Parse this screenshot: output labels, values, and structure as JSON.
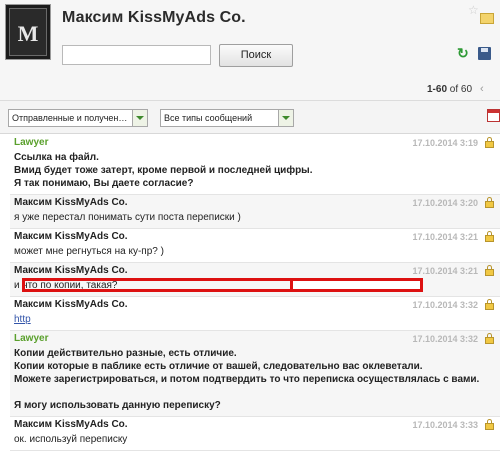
{
  "header": {
    "title": "Максим KissMyAds Co.",
    "avatar_text": "M",
    "search_placeholder": "",
    "search_button": "Поиск",
    "pager": {
      "range": "1-60",
      "of": "of 60"
    }
  },
  "toolbar": {
    "filter_direction": "Отправленные и получен…",
    "filter_type": "Все типы сообщений"
  },
  "messages": [
    {
      "sender": "Lawyer",
      "green": true,
      "date": "17.10.2014 3:19",
      "bold": true,
      "lines": [
        "Ссылка на файл.",
        "Вмид будет тоже затерт, кроме первой и последней цифры.",
        "Я так понимаю, Вы даете согласие?"
      ]
    },
    {
      "sender": "Максим KissMyAds Co.",
      "green": false,
      "date": "17.10.2014 3:20",
      "bold": false,
      "lines": [
        "я уже перестал понимать сути поста переписки )"
      ]
    },
    {
      "sender": "Максим KissMyAds Co.",
      "green": false,
      "date": "17.10.2014 3:21",
      "bold": false,
      "lines": [
        "может мне регнуться на ку-пр? )"
      ]
    },
    {
      "sender": "Максим KissMyAds Co.",
      "green": false,
      "date": "17.10.2014 3:21",
      "bold": false,
      "lines": [
        "и что по копии, такая?"
      ]
    },
    {
      "sender": "Максим KissMyAds Co.",
      "green": false,
      "date": "17.10.2014 3:32",
      "bold": false,
      "link": "http"
    },
    {
      "sender": "Lawyer",
      "green": true,
      "date": "17.10.2014 3:32",
      "bold": true,
      "lines": [
        "Копии действительно разные, есть отличие.",
        "Копии которые в паблике есть отличие от вашей, следовательно вас оклеветали.",
        "Можете зарегистрироваться, и потом подтвердить то что переписка осуществлялась с вами.",
        "",
        "Я могу использовать данную переписку?"
      ]
    },
    {
      "sender": "Максим KissMyAds Co.",
      "green": false,
      "date": "17.10.2014 3:33",
      "bold": false,
      "lines": [
        "ок. используй переписку"
      ]
    }
  ]
}
